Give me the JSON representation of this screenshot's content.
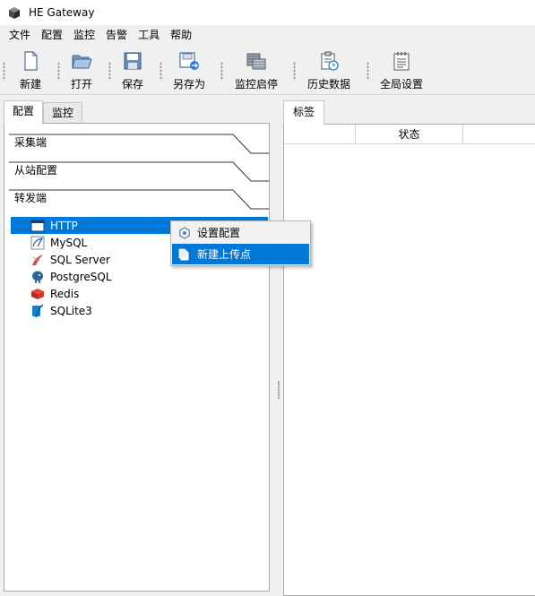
{
  "window": {
    "title": "HE Gateway",
    "icon": "gateway-app-icon"
  },
  "menu": [
    "文件",
    "配置",
    "监控",
    "告警",
    "工具",
    "帮助"
  ],
  "toolbar": [
    {
      "label": "新建",
      "icon": "new-file-icon"
    },
    {
      "label": "打开",
      "icon": "open-folder-icon"
    },
    {
      "label": "保存",
      "icon": "save-disk-icon"
    },
    {
      "label": "另存为",
      "icon": "save-as-icon"
    },
    {
      "label": "监控启停",
      "icon": "monitor-toggle-icon"
    },
    {
      "label": "历史数据",
      "icon": "history-data-icon"
    },
    {
      "label": "全局设置",
      "icon": "global-settings-icon"
    }
  ],
  "left_tabs": {
    "config": "配置",
    "monitor": "监控"
  },
  "sections": {
    "collect": "采集端",
    "slave": "从站配置",
    "forward": "转发端"
  },
  "tree": [
    {
      "label": "HTTP",
      "icon": "http-window-icon",
      "selected": true
    },
    {
      "label": "MySQL",
      "icon": "mysql-dolphin-icon"
    },
    {
      "label": "SQL Server",
      "icon": "sqlserver-icon"
    },
    {
      "label": "PostgreSQL",
      "icon": "postgresql-elephant-icon"
    },
    {
      "label": "Redis",
      "icon": "redis-cube-icon"
    },
    {
      "label": "SQLite3",
      "icon": "sqlite-feather-icon"
    }
  ],
  "context_menu": [
    {
      "label": "设置配置",
      "icon": "settings-icon"
    },
    {
      "label": "新建上传点",
      "icon": "new-upload-point-icon",
      "highlighted": true
    }
  ],
  "right_tab": "标签",
  "table_header": [
    "",
    "状态",
    ""
  ],
  "colors": {
    "selection": "#0078d7",
    "background": "#f0f0f0",
    "border": "#a8a8a8"
  }
}
